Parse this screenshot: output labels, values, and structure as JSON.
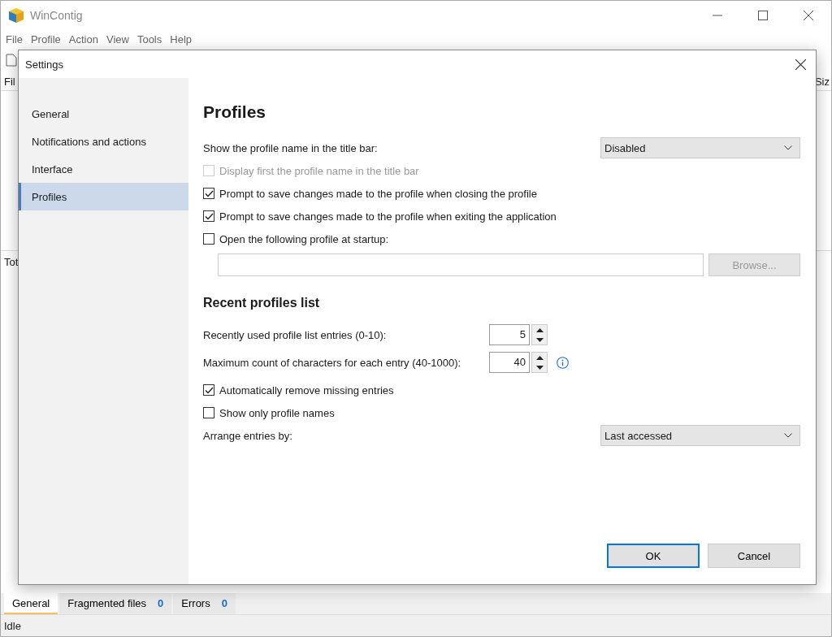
{
  "app": {
    "title": "WinContig",
    "menu": [
      "File",
      "Profile",
      "Action",
      "View",
      "Tools",
      "Help"
    ],
    "list_header_left": "Fil",
    "list_header_right": "Siz",
    "totals_label": "Tot",
    "bottom_tabs": [
      {
        "label": "General",
        "selected": true
      },
      {
        "label": "Fragmented files",
        "count": "0",
        "selected": false
      },
      {
        "label": "Errors",
        "count": "0",
        "selected": false
      }
    ],
    "status": "Idle"
  },
  "dialog": {
    "title": "Settings",
    "nav": [
      {
        "label": "General",
        "selected": false
      },
      {
        "label": "Notifications and actions",
        "selected": false
      },
      {
        "label": "Interface",
        "selected": false
      },
      {
        "label": "Profiles",
        "selected": true
      }
    ],
    "heading": "Profiles",
    "items": [
      {
        "kind": "dropdown",
        "label": "Show the profile name in the title bar:",
        "value": "Disabled"
      },
      {
        "kind": "checkbox",
        "label": "Display first the profile name in the title bar",
        "checked": false,
        "disabled": true
      },
      {
        "kind": "checkbox",
        "label": "Prompt to save changes made to the profile when closing the profile",
        "checked": true,
        "disabled": false
      },
      {
        "kind": "checkbox",
        "label": "Prompt to save changes made to the profile when exiting the application",
        "checked": true,
        "disabled": false
      },
      {
        "kind": "checkbox",
        "label": "Open the following profile at startup:",
        "checked": false,
        "disabled": false
      },
      {
        "kind": "path",
        "button": "Browse...",
        "disabled": true
      },
      {
        "kind": "section",
        "label": "Recent profiles list"
      },
      {
        "kind": "spinner",
        "label": "Recently used profile list entries (0-10):",
        "value": "5",
        "info": false
      },
      {
        "kind": "spinner",
        "label": "Maximum count of characters for each entry (40-1000):",
        "value": "40",
        "info": true
      },
      {
        "kind": "checkbox",
        "label": "Automatically remove missing entries",
        "checked": true,
        "disabled": false
      },
      {
        "kind": "checkbox",
        "label": "Show only profile names",
        "checked": false,
        "disabled": false
      },
      {
        "kind": "dropdown",
        "label": "Arrange entries by:",
        "value": "Last accessed"
      }
    ],
    "buttons": [
      {
        "label": "OK",
        "default": true
      },
      {
        "label": "Cancel",
        "default": false
      }
    ]
  }
}
